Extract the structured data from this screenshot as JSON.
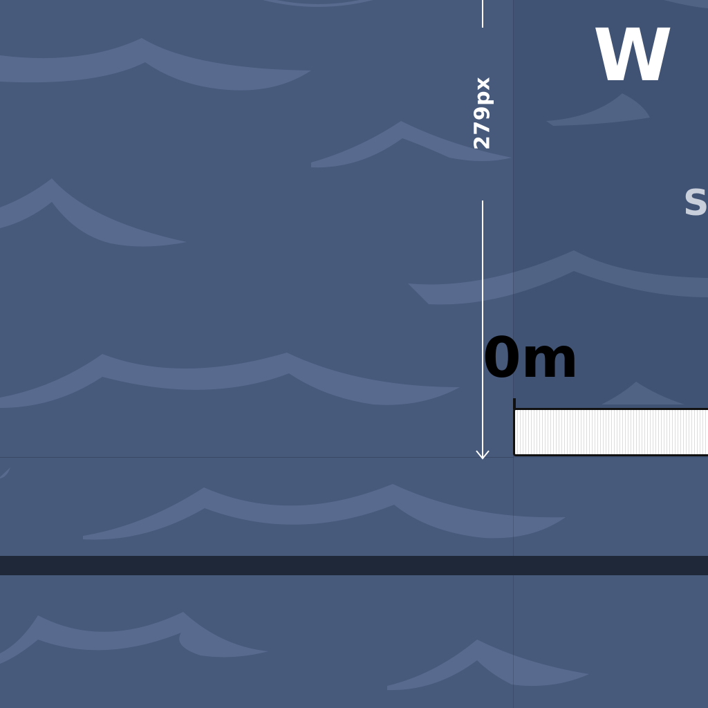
{
  "title": "W",
  "subtitle": "S",
  "measure": {
    "label": "279px"
  },
  "distance": {
    "label": "0m",
    "progress": 0
  },
  "colors": {
    "water": "#475a7c",
    "wave": "#5e7195",
    "ground": "#1f2838",
    "text": "#ffffff",
    "distance_text": "#000000"
  },
  "icons": {
    "measure": "down-arrow-icon"
  }
}
